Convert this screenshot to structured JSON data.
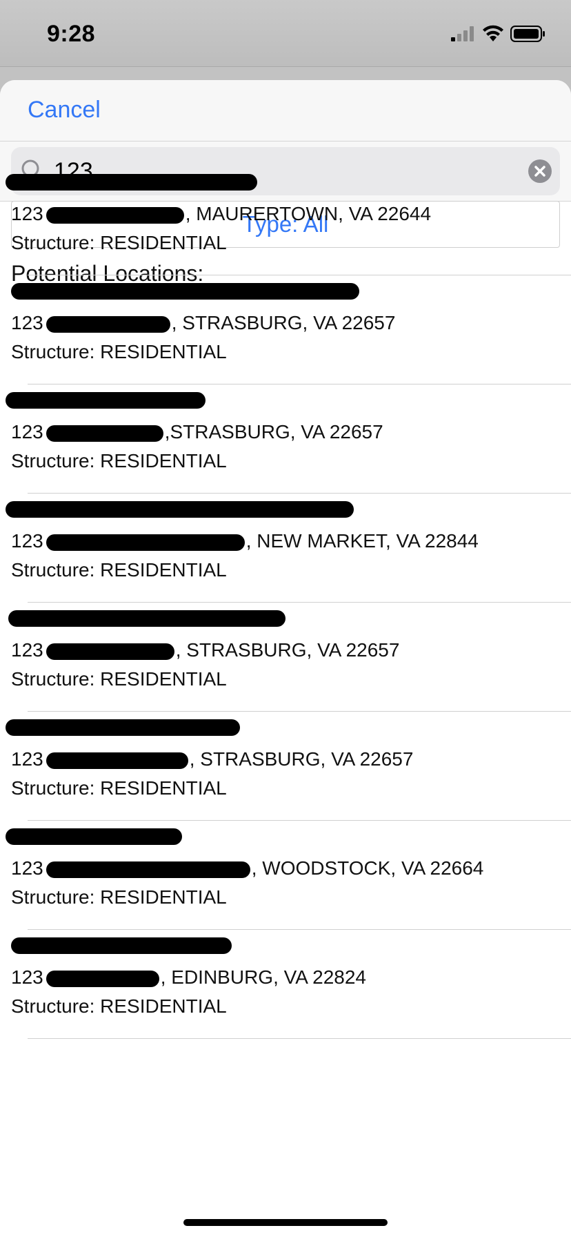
{
  "status_bar": {
    "time": "9:28"
  },
  "nav": {
    "cancel_label": "Cancel"
  },
  "search": {
    "value": "123"
  },
  "type_filter": {
    "label": "Type: All"
  },
  "section": {
    "title": "Potential Locations:"
  },
  "results": [
    {
      "prefix": "123",
      "suffix": ", MAURERTOWN, VA 22644",
      "structure": "Structure: RESIDENTIAL"
    },
    {
      "prefix": "123",
      "suffix": ", STRASBURG, VA 22657",
      "structure": "Structure: RESIDENTIAL"
    },
    {
      "prefix": "123",
      "suffix": ",STRASBURG, VA 22657",
      "structure": "Structure: RESIDENTIAL"
    },
    {
      "prefix": "123",
      "suffix": ", NEW MARKET, VA 22844",
      "structure": "Structure: RESIDENTIAL"
    },
    {
      "prefix": "123",
      "suffix": ", STRASBURG, VA 22657",
      "structure": "Structure: RESIDENTIAL"
    },
    {
      "prefix": "123",
      "suffix": ", STRASBURG, VA 22657",
      "structure": "Structure: RESIDENTIAL"
    },
    {
      "prefix": "123",
      "suffix": ", WOODSTOCK, VA 22664",
      "structure": "Structure: RESIDENTIAL"
    },
    {
      "prefix": "123",
      "suffix": ", EDINBURG, VA 22824",
      "structure": "Structure: RESIDENTIAL"
    }
  ],
  "icons": {
    "search": "magnifier-icon",
    "clear": "clear-circle-icon",
    "signal": "cellular-signal-icon",
    "wifi": "wifi-icon",
    "battery": "battery-icon"
  },
  "colors": {
    "accent": "#3478f6",
    "redaction": "#000000"
  }
}
